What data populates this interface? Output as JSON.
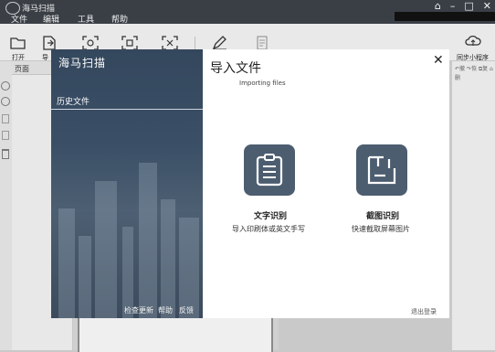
{
  "window": {
    "app_title": "海马扫描",
    "menus": [
      "文件",
      "编辑",
      "工具",
      "帮助"
    ],
    "controls": [
      "⌂",
      "–",
      "□",
      "✕"
    ]
  },
  "toolbar": {
    "open_label": "打开",
    "import_label": "导",
    "sync_label": "同步小程序"
  },
  "panels": {
    "page_label": "页面",
    "right_tools_text": "↶撤 ↷恢 ⧉复 ⌂删"
  },
  "modal": {
    "logo_text": "海马扫描",
    "history_label": "历史文件",
    "footer_links": [
      "检查更新",
      "帮助",
      "反馈"
    ],
    "title": "导入文件",
    "subtitle": "Importing files",
    "close_label": "✕",
    "features": [
      {
        "title": "文字识别",
        "desc": "导入印刷体或英文手写",
        "icon": "ocr-document-icon"
      },
      {
        "title": "截图识别",
        "desc": "快速截取屏幕图片",
        "icon": "screenshot-crop-icon"
      }
    ],
    "logout_label": "退出登录"
  }
}
